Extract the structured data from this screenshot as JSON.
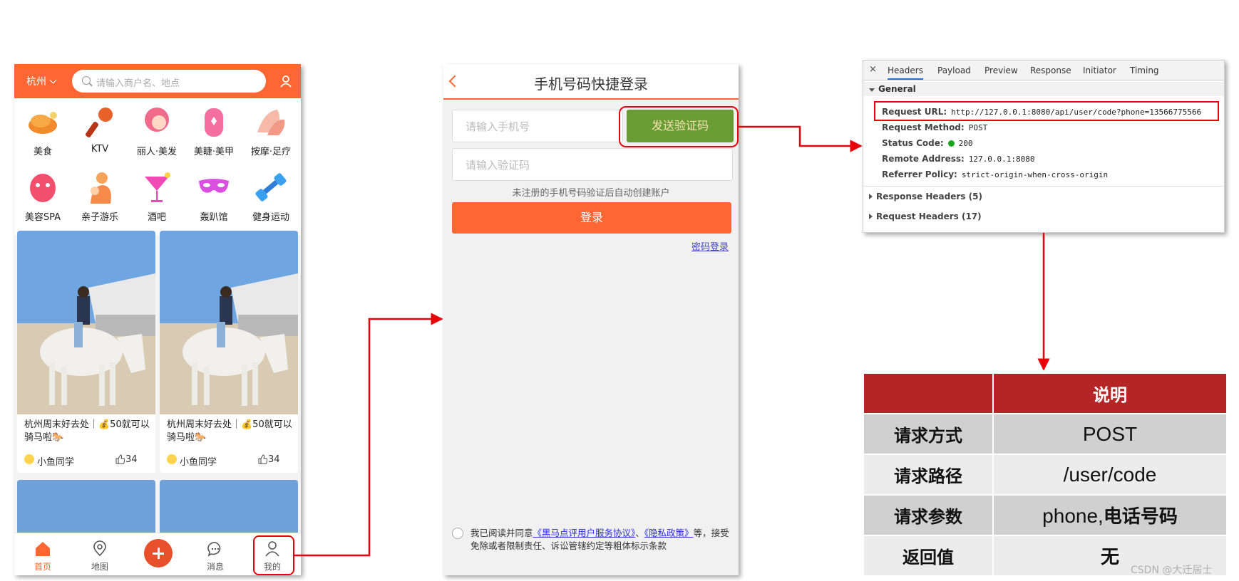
{
  "home": {
    "city": "杭州",
    "search_placeholder": "请输入商户名、地点",
    "categories": [
      {
        "label": "美食",
        "icon": "roast-chicken-icon"
      },
      {
        "label": "KTV",
        "icon": "microphone-icon"
      },
      {
        "label": "丽人·美发",
        "icon": "hair-icon"
      },
      {
        "label": "美睫·美甲",
        "icon": "nail-icon"
      },
      {
        "label": "按摩·足疗",
        "icon": "massage-icon"
      },
      {
        "label": "美容SPA",
        "icon": "face-mask-icon"
      },
      {
        "label": "亲子游乐",
        "icon": "family-icon"
      },
      {
        "label": "酒吧",
        "icon": "cocktail-icon"
      },
      {
        "label": "轰趴馆",
        "icon": "party-mask-icon"
      },
      {
        "label": "健身运动",
        "icon": "dumbbell-icon"
      }
    ],
    "cards": [
      {
        "title": "杭州周末好去处｜💰50就可以骑马啦🐎",
        "author": "小鱼同学",
        "likes": "34"
      },
      {
        "title": "杭州周末好去处｜💰50就可以骑马啦🐎",
        "author": "小鱼同学",
        "likes": "34"
      }
    ],
    "tabs": [
      {
        "label": "首页",
        "icon": "home-icon"
      },
      {
        "label": "地图",
        "icon": "map-pin-icon"
      },
      {
        "label": "",
        "icon": "plus-icon"
      },
      {
        "label": "消息",
        "icon": "chat-icon"
      },
      {
        "label": "我的",
        "icon": "user-icon"
      }
    ]
  },
  "login": {
    "title": "手机号码快捷登录",
    "phone_placeholder": "请输入手机号",
    "send_code_label": "发送验证码",
    "code_placeholder": "请输入验证码",
    "hint": "未注册的手机号码验证后自动创建账户",
    "login_label": "登录",
    "password_login": "密码登录",
    "agree_prefix": "我已阅读并同意",
    "agree_link1": "《黑马点评用户服务协议》",
    "agree_sep": "、",
    "agree_link2": "《隐私政策》",
    "agree_suffix": "等，接受免除或者限制责任、诉讼管辖约定等粗体标示条款"
  },
  "devtools": {
    "close": "×",
    "tabs": [
      "Headers",
      "Payload",
      "Preview",
      "Response",
      "Initiator",
      "Timing"
    ],
    "general_label": "General",
    "request_url_key": "Request URL:",
    "request_url": "http://127.0.0.1:8080/api/user/code?phone=13566775566",
    "method_key": "Request Method:",
    "method": "POST",
    "status_key": "Status Code:",
    "status": "200",
    "remote_key": "Remote Address:",
    "remote": "127.0.0.1:8080",
    "referrer_key": "Referrer Policy:",
    "referrer": "strict-origin-when-cross-origin",
    "response_headers": "Response Headers (5)",
    "request_headers": "Request Headers (17)"
  },
  "table": {
    "header": "说明",
    "rows": [
      {
        "key": "请求方式",
        "value": "POST"
      },
      {
        "key": "请求路径",
        "value": "/user/code"
      },
      {
        "key": "请求参数",
        "value_prefix": "phone,",
        "value_bold": "电话号码"
      },
      {
        "key": "返回值",
        "value": "无"
      }
    ]
  },
  "watermark": "CSDN @大迁居士",
  "colors": {
    "brand_orange": "#ff6633",
    "send_green": "#6a9c36",
    "highlight_red": "#e8000b",
    "table_header": "#b52525"
  }
}
